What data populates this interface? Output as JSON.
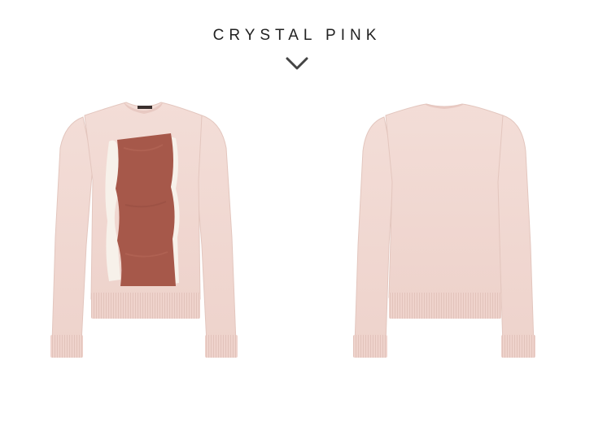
{
  "header": {
    "color_name": "CRYSTAL PINK",
    "chevron_icon": "chevron-down-icon"
  },
  "images": {
    "front": {
      "subject": "pink-sweater-front"
    },
    "back": {
      "subject": "pink-sweater-back"
    }
  },
  "colors": {
    "sweater_pink": "#f1d9d3",
    "sweater_shadow": "#e6c8c1",
    "panel_rust": "#a6584a",
    "panel_cream": "#f7f1ea",
    "title_text": "#222222"
  }
}
